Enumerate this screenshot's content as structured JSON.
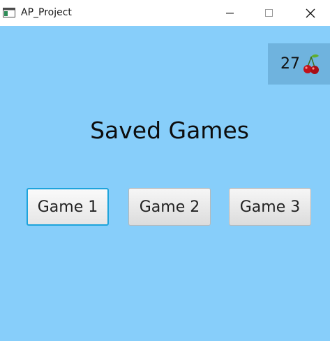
{
  "window": {
    "title": "AP_Project",
    "icons": {
      "app": "app-window-icon",
      "minimize": "minimize-icon",
      "maximize": "maximize-icon",
      "close": "close-icon"
    }
  },
  "header": {
    "coin_count": "27",
    "coin_icon": "cherry-icon"
  },
  "main": {
    "title": "Saved Games",
    "buttons": [
      {
        "label": "Game 1",
        "focused": true
      },
      {
        "label": "Game 2",
        "focused": false
      },
      {
        "label": "Game 3",
        "focused": false
      }
    ]
  },
  "colors": {
    "background": "#87cefa",
    "coin_box": "#6fb3de",
    "focus_ring": "#1ea4dc"
  }
}
